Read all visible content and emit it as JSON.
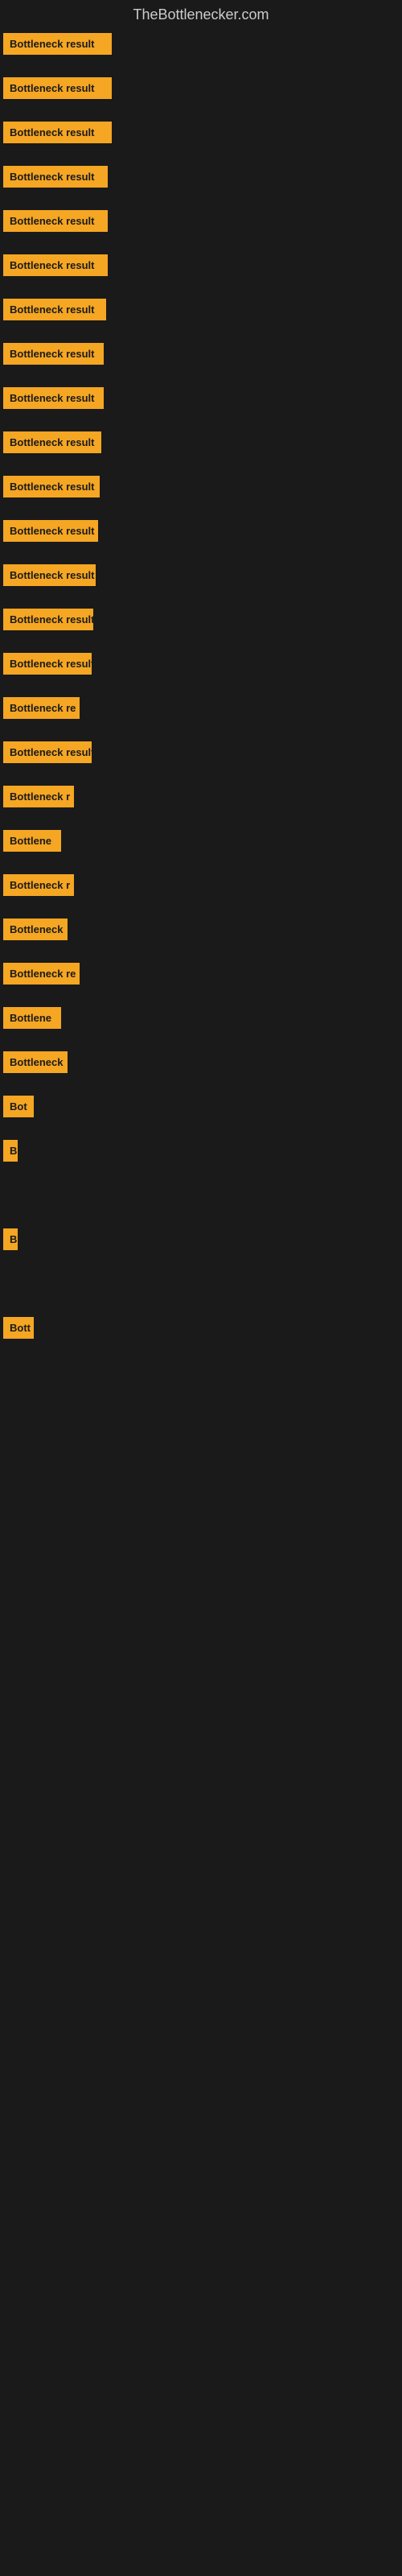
{
  "header": {
    "title": "TheBottlenecker.com"
  },
  "items": [
    {
      "label": "Bottleneck result",
      "width": 135,
      "top_offset": 0
    },
    {
      "label": "Bottleneck result",
      "width": 135,
      "top_offset": 0
    },
    {
      "label": "Bottleneck result",
      "width": 135,
      "top_offset": 0
    },
    {
      "label": "Bottleneck result",
      "width": 130,
      "top_offset": 0
    },
    {
      "label": "Bottleneck result",
      "width": 130,
      "top_offset": 0
    },
    {
      "label": "Bottleneck result",
      "width": 130,
      "top_offset": 0
    },
    {
      "label": "Bottleneck result",
      "width": 128,
      "top_offset": 0
    },
    {
      "label": "Bottleneck result",
      "width": 125,
      "top_offset": 0
    },
    {
      "label": "Bottleneck result",
      "width": 125,
      "top_offset": 0
    },
    {
      "label": "Bottleneck result",
      "width": 122,
      "top_offset": 0
    },
    {
      "label": "Bottleneck result",
      "width": 120,
      "top_offset": 0
    },
    {
      "label": "Bottleneck result",
      "width": 118,
      "top_offset": 0
    },
    {
      "label": "Bottleneck result",
      "width": 115,
      "top_offset": 0
    },
    {
      "label": "Bottleneck result",
      "width": 112,
      "top_offset": 0
    },
    {
      "label": "Bottleneck result",
      "width": 110,
      "top_offset": 0
    },
    {
      "label": "Bottleneck re",
      "width": 95,
      "top_offset": 0
    },
    {
      "label": "Bottleneck result",
      "width": 110,
      "top_offset": 0
    },
    {
      "label": "Bottleneck r",
      "width": 88,
      "top_offset": 0
    },
    {
      "label": "Bottlene",
      "width": 72,
      "top_offset": 0
    },
    {
      "label": "Bottleneck r",
      "width": 88,
      "top_offset": 0
    },
    {
      "label": "Bottleneck",
      "width": 80,
      "top_offset": 0
    },
    {
      "label": "Bottleneck re",
      "width": 95,
      "top_offset": 0
    },
    {
      "label": "Bottlene",
      "width": 72,
      "top_offset": 0
    },
    {
      "label": "Bottleneck",
      "width": 80,
      "top_offset": 0
    },
    {
      "label": "Bot",
      "width": 38,
      "top_offset": 0
    },
    {
      "label": "B",
      "width": 18,
      "top_offset": 0
    },
    {
      "label": "",
      "width": 0,
      "top_offset": 0
    },
    {
      "label": "B",
      "width": 18,
      "top_offset": 0
    },
    {
      "label": "",
      "width": 0,
      "top_offset": 0
    },
    {
      "label": "Bott",
      "width": 38,
      "top_offset": 0
    },
    {
      "label": "",
      "width": 0,
      "top_offset": 0
    },
    {
      "label": "",
      "width": 0,
      "top_offset": 0
    },
    {
      "label": "",
      "width": 0,
      "top_offset": 0
    },
    {
      "label": "",
      "width": 0,
      "top_offset": 0
    },
    {
      "label": "",
      "width": 0,
      "top_offset": 0
    },
    {
      "label": "",
      "width": 0,
      "top_offset": 0
    }
  ]
}
